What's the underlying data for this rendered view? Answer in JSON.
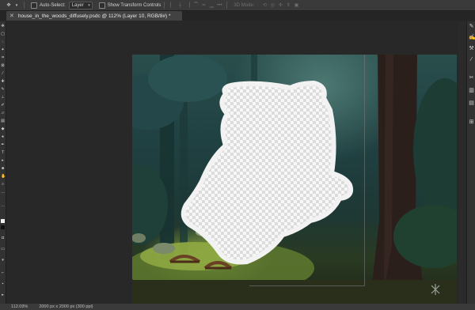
{
  "options_bar": {
    "auto_select_label": "Auto-Select:",
    "auto_select_target": "Layer",
    "show_transform_label": "Show Transform Controls",
    "mode_3d_label": "3D Mode:"
  },
  "tab": {
    "title": "house_in_the_woods_diffusely.psdc @ 112% (Layer 10, RGB/8#) *"
  },
  "status": {
    "zoom": "112.09%",
    "doc_size": "2000 px x 2000 px (300 ppi)"
  },
  "icons": [
    "move-icon",
    "chevron-down-icon",
    "checkbox-icon",
    "tab-close-icon",
    "wand-tool-icon",
    "brush-tool-icon",
    "scissors-panel-icon",
    "watermark-logo"
  ]
}
